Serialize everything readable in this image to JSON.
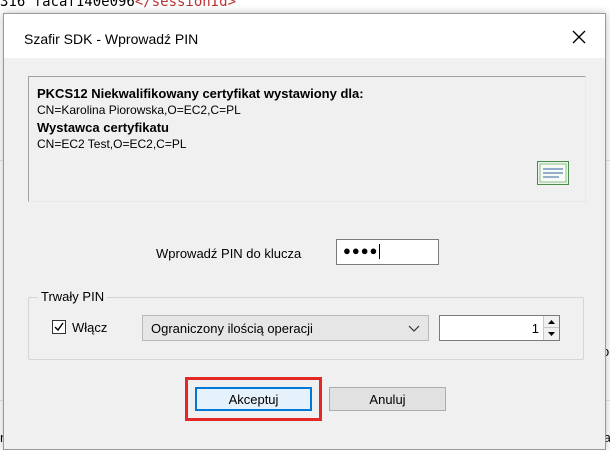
{
  "background": {
    "code_fragment_prefix": "316 facaf140e096",
    "code_fragment_tag": "</sessionId>",
    "side_right_1": "o",
    "side_right_2": "ta",
    "side_left_bottom": "ri"
  },
  "dialog": {
    "title": "Szafir SDK - Wprowadź PIN",
    "info": {
      "line1": "PKCS12 Niekwalifikowany certyfikat wystawiony dla:",
      "line2": "CN=Karolina Piorowska,O=EC2,C=PL",
      "line3": "Wystawca certyfikatu",
      "line4": "CN=EC2 Test,O=EC2,C=PL"
    },
    "pin_label": "Wprowadź PIN do klucza",
    "pin_value": "●●●●",
    "group_title": "Trwały PIN",
    "checkbox_label": "Włącz",
    "checkbox_checked": true,
    "select_value": "Ograniczony ilością operacji",
    "spinner_value": "1",
    "accept_label": "Akceptuj",
    "cancel_label": "Anuluj"
  },
  "colors": {
    "highlight": "#e32727",
    "default_button_border": "#0078d7"
  }
}
